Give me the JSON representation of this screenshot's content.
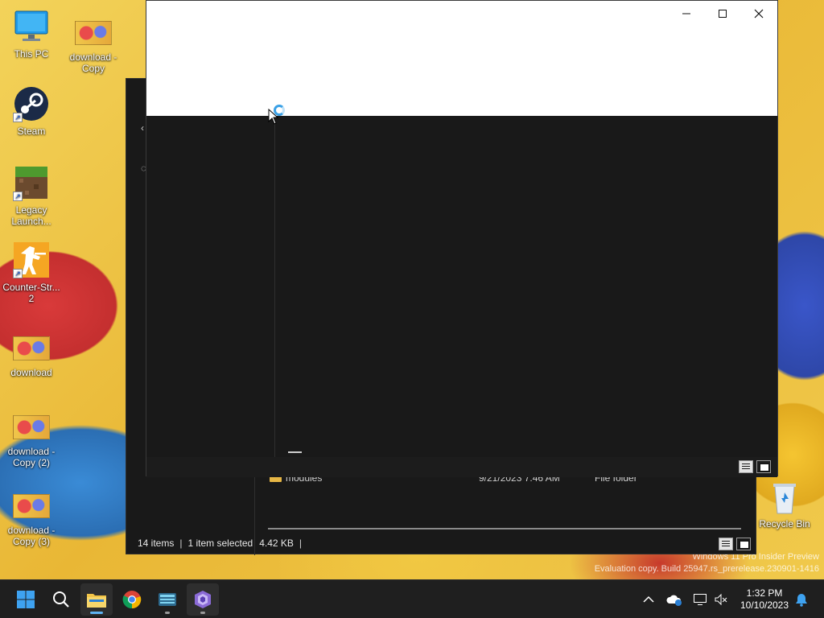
{
  "desktop": {
    "icons": [
      {
        "label": "This PC"
      },
      {
        "label": "download -\nCopy"
      },
      {
        "label": "Steam"
      },
      {
        "label": "Legacy\nLaunch..."
      },
      {
        "label": "Counter-Str...\n2"
      },
      {
        "label": "download"
      },
      {
        "label": "download -\nCopy (2)"
      },
      {
        "label": "download -\nCopy (3)"
      },
      {
        "label": "Recycle Bin"
      }
    ],
    "watermark": {
      "line1": "Windows 11 Pro Insider Preview",
      "line2": "Evaluation copy. Build 25947.rs_prerelease.230901-1416"
    }
  },
  "explorer": {
    "row": {
      "name": "modules",
      "date": "9/21/2023 7:46 AM",
      "type": "File folder"
    },
    "status": {
      "items": "14 items",
      "selected": "1 item selected",
      "size": "4.42 KB",
      "sep": "|"
    }
  },
  "front_window": {
    "minimize": "—",
    "maximize": "☐",
    "close": "✕"
  },
  "taskbar": {
    "apps": [
      "Start",
      "Search",
      "File Explorer",
      "Google Chrome",
      "Terminal",
      "Visual Studio"
    ],
    "clock": {
      "time": "1:32 PM",
      "date": "10/10/2023"
    }
  },
  "colors": {
    "accent": "#3aa0e6",
    "folder": "#e6b645",
    "taskbar": "#1f1f1f"
  }
}
